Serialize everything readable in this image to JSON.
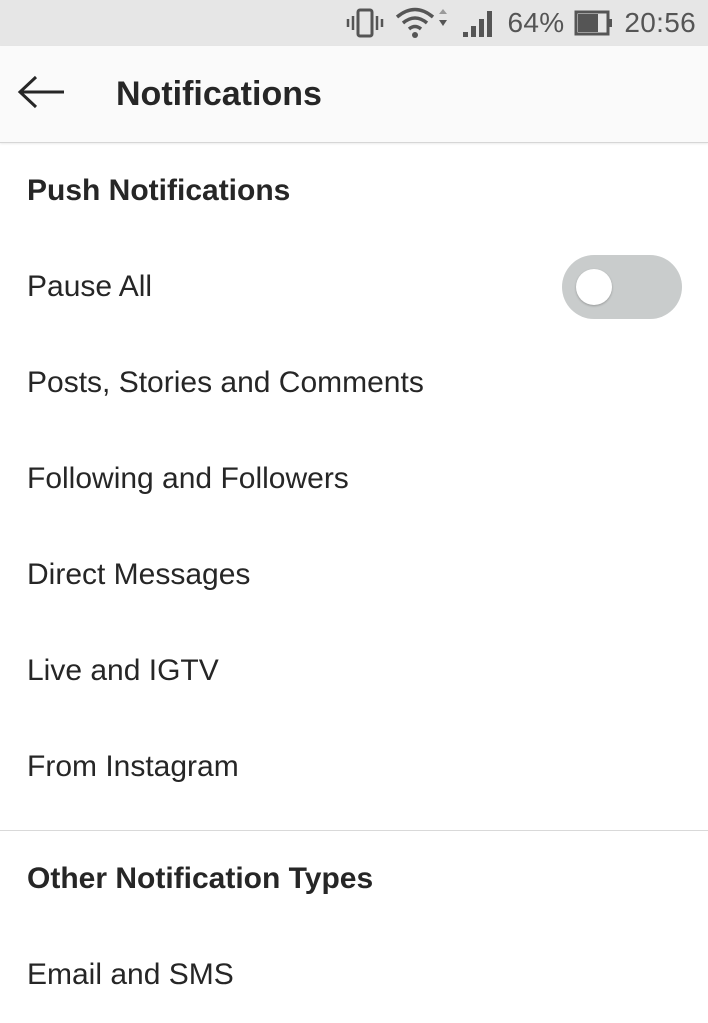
{
  "status_bar": {
    "battery_percent": "64%",
    "time": "20:56",
    "icons": [
      "vibrate-icon",
      "wifi-icon",
      "signal-icon",
      "battery-icon"
    ]
  },
  "app_bar": {
    "back_icon": "arrow-left-icon",
    "title": "Notifications"
  },
  "sections": {
    "push": {
      "header": "Push Notifications",
      "pause_all_label": "Pause All",
      "pause_all_on": false,
      "items": [
        "Posts, Stories and Comments",
        "Following and Followers",
        "Direct Messages",
        "Live and IGTV",
        "From Instagram"
      ]
    },
    "other": {
      "header": "Other Notification Types",
      "items": [
        "Email and SMS"
      ]
    }
  },
  "colors": {
    "text": "#262626",
    "toggle_off_track": "#c9cccc",
    "status_bar_bg": "#e6e6e6"
  }
}
